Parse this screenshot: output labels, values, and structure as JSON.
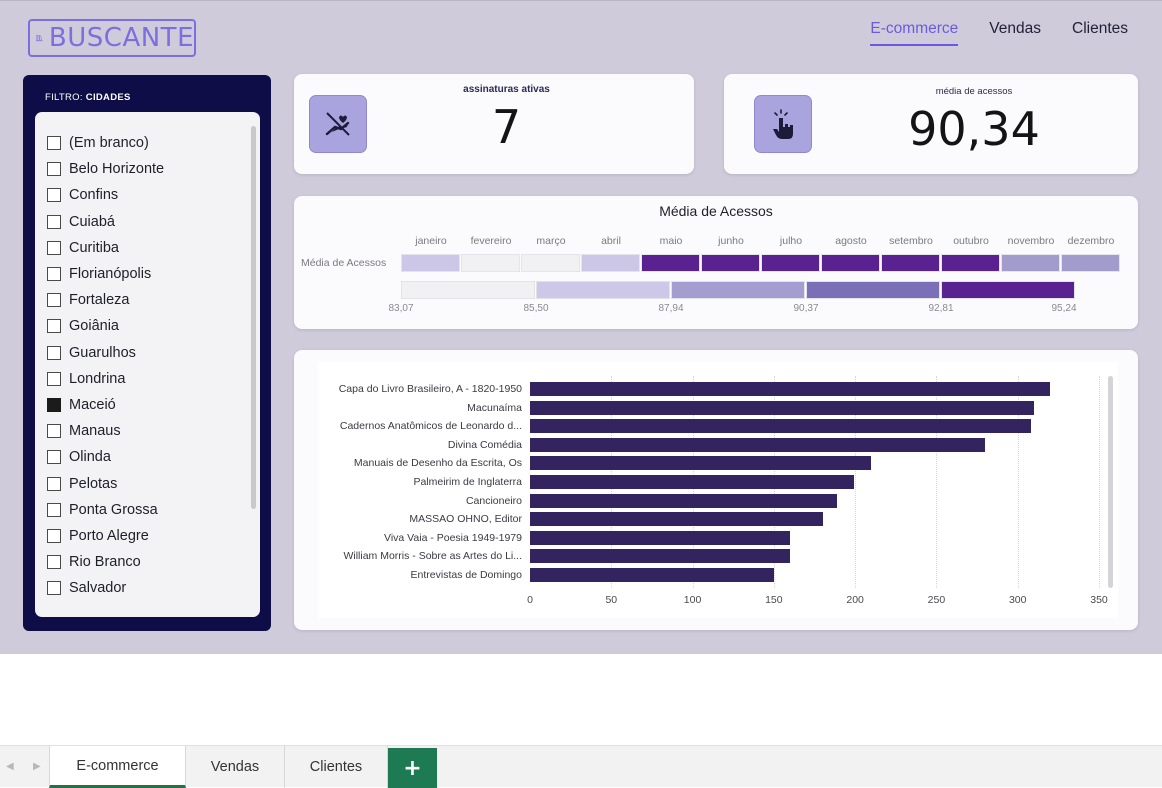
{
  "app": {
    "logo_text": "BUSCANTE",
    "nav": [
      {
        "label": "E-commerce",
        "active": true
      },
      {
        "label": "Vendas",
        "active": false
      },
      {
        "label": "Clientes",
        "active": false
      }
    ]
  },
  "filter": {
    "title_prefix": "FILTRO:",
    "title_field": "CIDADES",
    "items": [
      {
        "label": "(Em branco)",
        "checked": false
      },
      {
        "label": "Belo Horizonte",
        "checked": false
      },
      {
        "label": "Confins",
        "checked": false
      },
      {
        "label": "Cuiabá",
        "checked": false
      },
      {
        "label": "Curitiba",
        "checked": false
      },
      {
        "label": "Florianópolis",
        "checked": false
      },
      {
        "label": "Fortaleza",
        "checked": false
      },
      {
        "label": "Goiânia",
        "checked": false
      },
      {
        "label": "Guarulhos",
        "checked": false
      },
      {
        "label": "Londrina",
        "checked": false
      },
      {
        "label": "Maceió",
        "checked": true
      },
      {
        "label": "Manaus",
        "checked": false
      },
      {
        "label": "Olinda",
        "checked": false
      },
      {
        "label": "Pelotas",
        "checked": false
      },
      {
        "label": "Ponta Grossa",
        "checked": false
      },
      {
        "label": "Porto Alegre",
        "checked": false
      },
      {
        "label": "Rio Branco",
        "checked": false
      },
      {
        "label": "Salvador",
        "checked": false
      }
    ]
  },
  "kpis": {
    "subscriptions": {
      "label": "assinaturas ativas",
      "value": "7",
      "icon": "hand-heart-icon"
    },
    "accesses": {
      "label": "média de acessos",
      "value": "90,34",
      "icon": "tap-hand-icon"
    }
  },
  "heatmap": {
    "title": "Média de Acessos",
    "row_label": "Média de Acessos",
    "months": [
      "janeiro",
      "fevereiro",
      "março",
      "abril",
      "maio",
      "junho",
      "julho",
      "agosto",
      "setembro",
      "outubro",
      "novembro",
      "dezembro"
    ],
    "cell_colors": [
      "#ccc7e6",
      "#f1f1f4",
      "#f1f1f4",
      "#ccc7e6",
      "#5a2290",
      "#5a2290",
      "#5a2290",
      "#5a2290",
      "#5a2290",
      "#5a2290",
      "#a29ccc",
      "#a29ccc"
    ],
    "legend_colors": [
      "#f1f1f4",
      "#cdc8e8",
      "#a49ed0",
      "#7b70b8",
      "#5a2290"
    ],
    "legend_ticks": [
      "83,07",
      "85,50",
      "87,94",
      "90,37",
      "92,81",
      "95,24"
    ]
  },
  "chart_data": {
    "type": "bar",
    "orientation": "horizontal",
    "categories": [
      "Capa do Livro Brasileiro, A - 1820-1950",
      "Macunaíma",
      "Cadernos Anatômicos de Leonardo d...",
      "Divina Comédia",
      "Manuais de Desenho da Escrita, Os",
      "Palmeirim de Inglaterra",
      "Cancioneiro",
      "MASSAO OHNO, Editor",
      "Viva Vaia - Poesia 1949-1979",
      "William Morris - Sobre as Artes do Li...",
      "Entrevistas de Domingo"
    ],
    "values": [
      320,
      310,
      308,
      280,
      210,
      199,
      189,
      180,
      160,
      160,
      150
    ],
    "xlim": [
      0,
      350
    ],
    "xticks": [
      "0",
      "50",
      "100",
      "150",
      "200",
      "250",
      "300",
      "350"
    ],
    "bar_color": "#33235e",
    "grid": true
  },
  "sheet_tabs": {
    "items": [
      {
        "label": "E-commerce",
        "active": true
      },
      {
        "label": "Vendas",
        "active": false
      },
      {
        "label": "Clientes",
        "active": false
      }
    ],
    "add_label": "+"
  }
}
